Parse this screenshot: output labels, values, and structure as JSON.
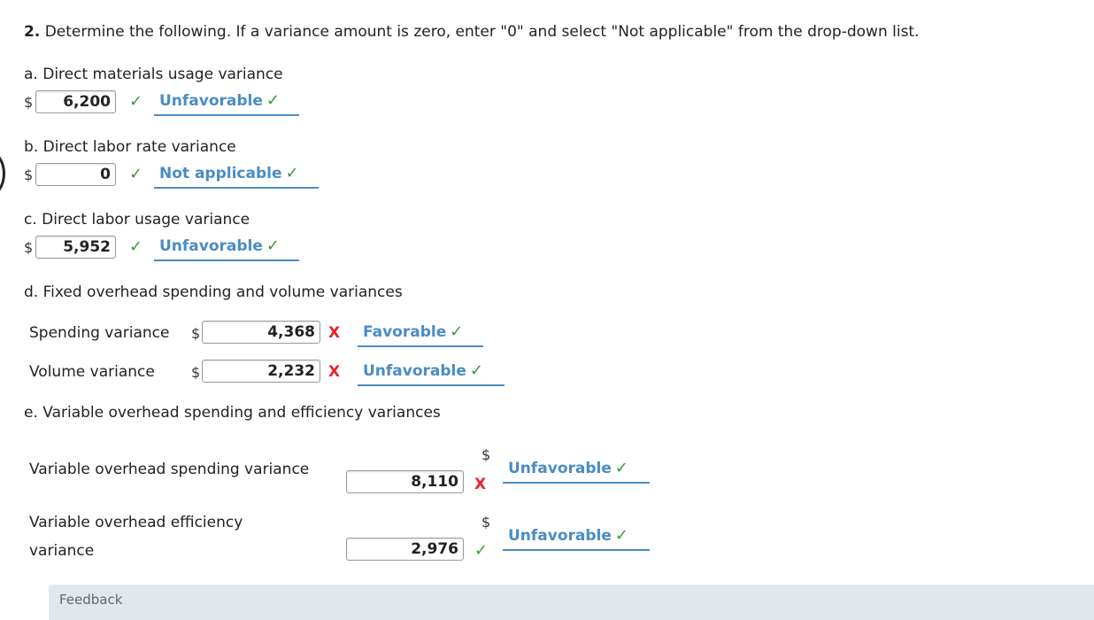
{
  "instruction": {
    "number": "2.",
    "text": " Determine the following. If a variance amount is zero, enter \"0\" and select \"Not applicable\" from the drop-down list."
  },
  "currency_symbol": "$",
  "icons": {
    "correct": "✓",
    "incorrect": "X"
  },
  "colors": {
    "correct_green": "#3a9a3a",
    "incorrect_red": "#e8232a",
    "select_blue": "#4a8cc4",
    "feedback_bg": "#e1e7ea"
  },
  "questions": {
    "a": {
      "label": "a. Direct materials usage variance",
      "amount": "6,200",
      "amount_status": "correct",
      "selection": "Unfavorable",
      "selection_status": "correct"
    },
    "b": {
      "label": "b. Direct labor rate variance",
      "amount": "0",
      "amount_status": "correct",
      "selection": "Not applicable",
      "selection_status": "correct"
    },
    "c": {
      "label": "c. Direct labor usage variance",
      "amount": "5,952",
      "amount_status": "correct",
      "selection": "Unfavorable",
      "selection_status": "correct"
    },
    "d": {
      "label": "d. Fixed overhead spending and volume variances",
      "rows": [
        {
          "label": "Spending variance",
          "amount": "4,368",
          "amount_status": "incorrect",
          "selection": "Favorable",
          "selection_status": "correct"
        },
        {
          "label": "Volume variance",
          "amount": "2,232",
          "amount_status": "incorrect",
          "selection": "Unfavorable",
          "selection_status": "correct"
        }
      ]
    },
    "e": {
      "label": "e. Variable overhead spending and efficiency variances",
      "rows": [
        {
          "label": "Variable overhead spending variance",
          "amount": "8,110",
          "amount_status": "incorrect",
          "selection": "Unfavorable",
          "selection_status": "correct"
        },
        {
          "label_line1": "Variable overhead efficiency",
          "label_line2": "variance",
          "amount": "2,976",
          "amount_status": "correct",
          "selection": "Unfavorable",
          "selection_status": "correct"
        }
      ]
    }
  },
  "feedback": {
    "label": "Feedback"
  }
}
